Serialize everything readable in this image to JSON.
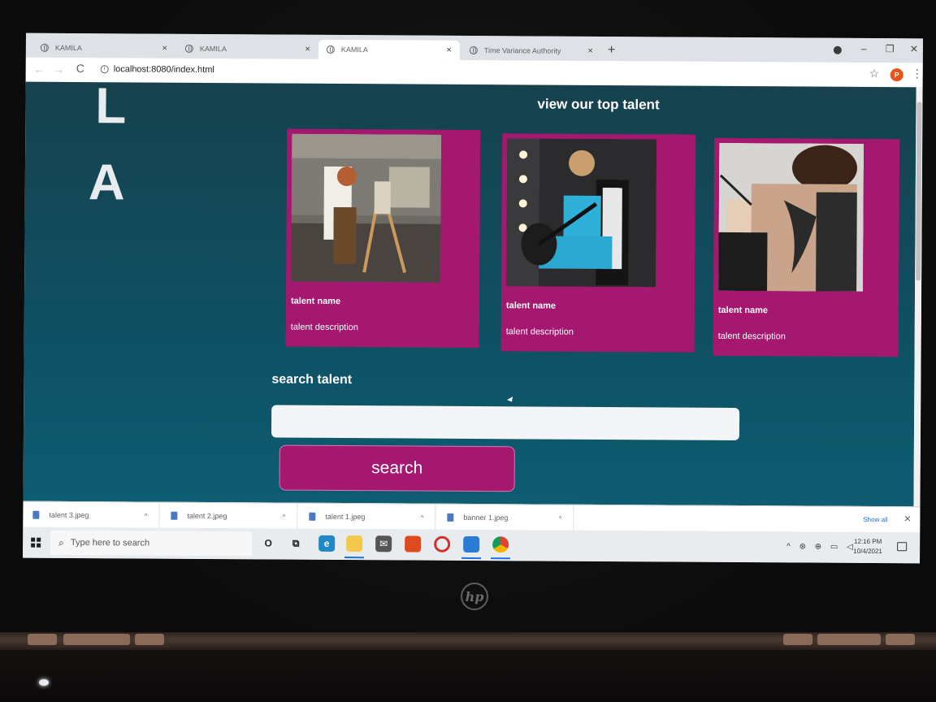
{
  "browser": {
    "tabs": [
      {
        "label": "KAMILA",
        "active": false
      },
      {
        "label": "KAMILA",
        "active": false
      },
      {
        "label": "KAMILA",
        "active": true
      },
      {
        "label": "Time Variance Authority",
        "active": false
      }
    ],
    "tab_close": "×",
    "new_tab": "+",
    "window_controls": {
      "minimize": "–",
      "maximize": "❐",
      "close": "✕"
    },
    "nav": {
      "back": "←",
      "forward": "→",
      "reload": "C"
    },
    "url": "localhost:8080/index.html",
    "star": "☆",
    "profile_initial": "P",
    "menu": "⋮"
  },
  "page": {
    "banner_letters": [
      "L",
      "A"
    ],
    "section_title": "view our top talent",
    "talents": [
      {
        "name": "talent name",
        "description": "talent description",
        "photo": "painter-photo"
      },
      {
        "name": "talent name",
        "description": "talent description",
        "photo": "musician-photo"
      },
      {
        "name": "talent name",
        "description": "talent description",
        "photo": "tattoo-artist-photo"
      }
    ],
    "search_title": "search talent",
    "search_placeholder": "",
    "search_button": "search"
  },
  "downloads": {
    "items": [
      "talent 3.jpeg",
      "talent 2.jpeg",
      "talent 1.jpeg",
      "banner 1.jpeg"
    ],
    "expand": "^",
    "show_all": "Show all",
    "close": "✕"
  },
  "taskbar": {
    "search_placeholder": "Type here to search",
    "search_icon": "⌕",
    "cortana": "O",
    "task_view": "⧉",
    "time": "12:16 PM",
    "date": "10/4/2021",
    "tray": "^ ⊛ ⊕ ▭ ◁"
  },
  "colors": {
    "card": "#a4196f",
    "page_top": "#16414d",
    "page_bottom": "#0e5c72"
  }
}
